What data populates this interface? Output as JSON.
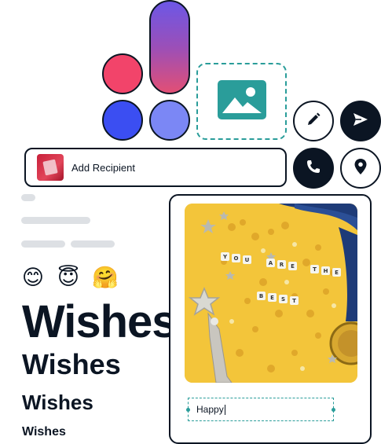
{
  "logo": {
    "colors": {
      "red": "#f2446a",
      "blue": "#3b4ef2",
      "lavender": "#7b87f5",
      "pill_top": "#6c57e6",
      "pill_bottom": "#e24f75"
    }
  },
  "image_drop": {
    "icon": "image-icon",
    "accent": "#2a9d9a"
  },
  "actions": {
    "edit": {
      "icon": "pencil-icon"
    },
    "send": {
      "icon": "send-icon"
    },
    "call": {
      "icon": "phone-icon"
    },
    "location": {
      "icon": "map-pin-icon"
    }
  },
  "recipient": {
    "label": "Add Recipient"
  },
  "emojis": [
    "😊",
    "😇",
    "🤗"
  ],
  "wishes": {
    "xl": "Wishes",
    "l": "Wishes",
    "m": "Wishes",
    "s": "Wishes"
  },
  "card": {
    "photo_letters": [
      "Y",
      "O",
      "U",
      "A",
      "R",
      "E",
      "T",
      "H",
      "E",
      "B",
      "E",
      "S",
      "T"
    ],
    "input_value": "Happy"
  },
  "colors": {
    "ink": "#0b1523",
    "teal": "#2a9d9a",
    "skeleton": "#dde0e4"
  }
}
